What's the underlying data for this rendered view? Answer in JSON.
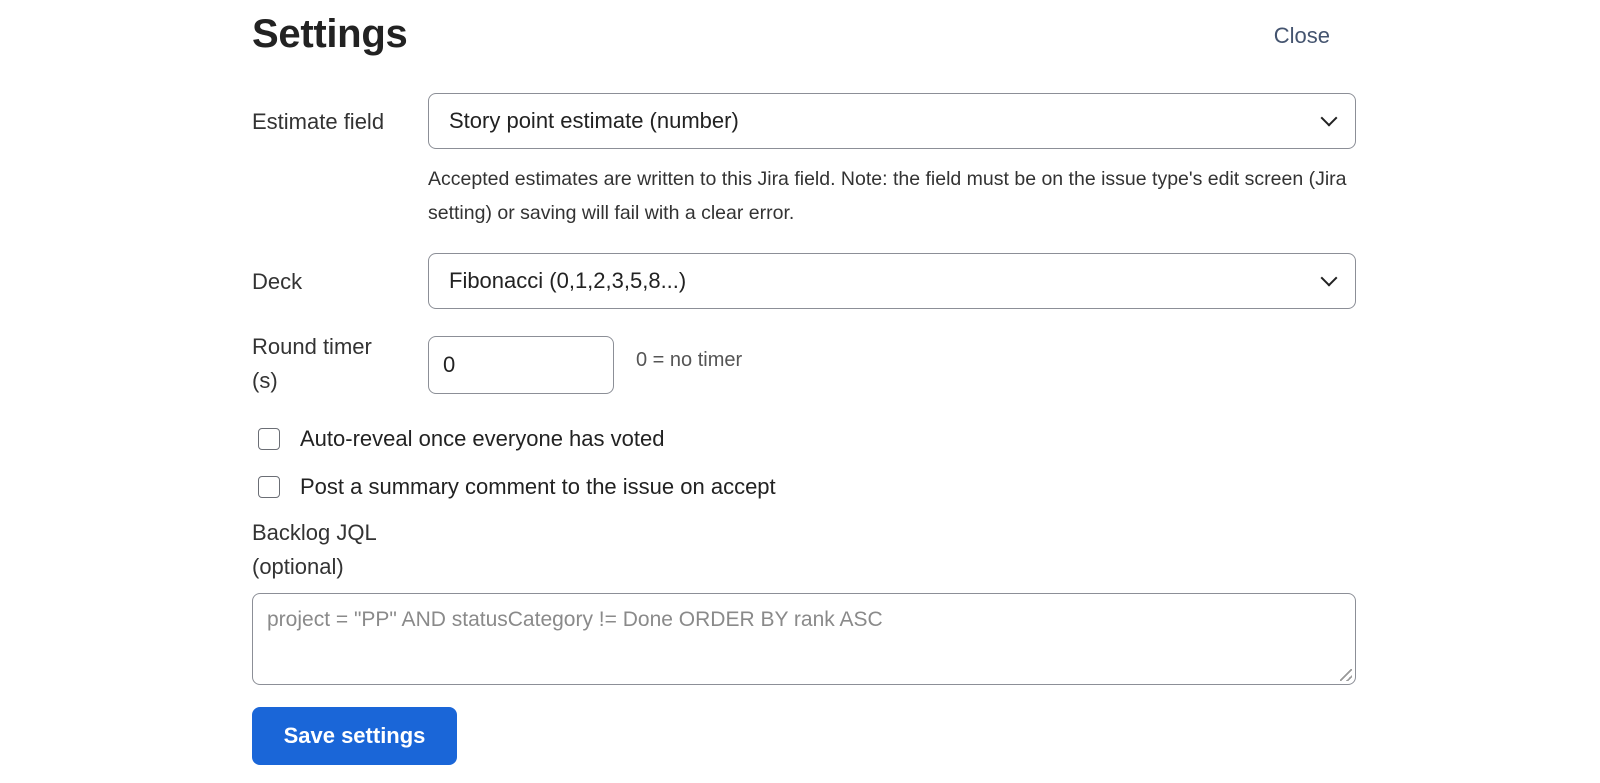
{
  "header": {
    "title": "Settings",
    "close_label": "Close"
  },
  "estimate_field": {
    "label": "Estimate field",
    "selected": "Story point estimate (number)",
    "help": "Accepted estimates are written to this Jira field. Note: the field must be on the issue type's edit screen (Jira setting) or saving will fail with a clear error."
  },
  "deck": {
    "label": "Deck",
    "selected": "Fibonacci (0,1,2,3,5,8...)"
  },
  "round_timer": {
    "label_line1": "Round timer",
    "label_line2": "(s)",
    "value": "0",
    "hint": "0 = no timer"
  },
  "options": {
    "auto_reveal": {
      "label": "Auto-reveal once everyone has voted",
      "checked": false
    },
    "post_summary": {
      "label": "Post a summary comment to the issue on accept",
      "checked": false
    }
  },
  "backlog_jql": {
    "label_line1": "Backlog JQL",
    "label_line2": "(optional)",
    "placeholder": "project = \"PP\" AND statusCategory != Done ORDER BY rank ASC",
    "value": ""
  },
  "actions": {
    "save_label": "Save settings"
  },
  "colors": {
    "primary": "#1a66d8",
    "text": "#222222",
    "border": "#8c8f97"
  }
}
